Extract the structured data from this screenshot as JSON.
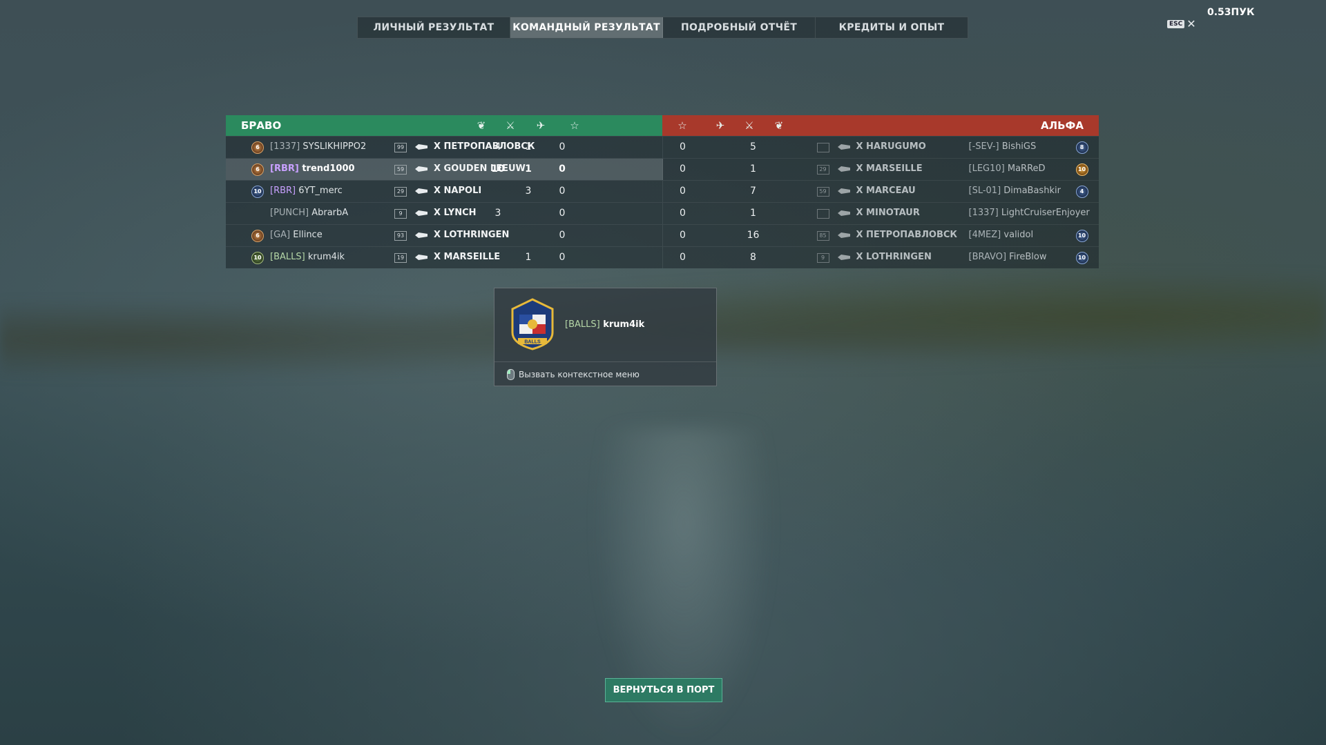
{
  "tabs": [
    {
      "label": "ЛИЧНЫЙ РЕЗУЛЬТАТ",
      "active": false
    },
    {
      "label": "КОМАНДНЫЙ РЕЗУЛЬТАТ",
      "active": true
    },
    {
      "label": "ПОДРОБНЫЙ ОТЧЁТ",
      "active": false
    },
    {
      "label": "КРЕДИТЫ И ОПЫТ",
      "active": false
    }
  ],
  "top_right": {
    "fps": "0.53ПУК",
    "esc_key": "ESC",
    "close_glyph": "✕"
  },
  "teams": {
    "left": {
      "name": "БРАВО",
      "color": "#2b8a5e",
      "header_icons": [
        "laurel-icon",
        "crossed-swords-icon",
        "plane-icon",
        "star-icon"
      ]
    },
    "right": {
      "name": "АЛЬФА",
      "color": "#a8392b",
      "header_icons": [
        "star-icon",
        "plane-icon",
        "crossed-swords-icon",
        "laurel-icon"
      ]
    }
  },
  "left_rows": [
    {
      "clan": "[1337]",
      "name": "SYSLIKHIPPO2",
      "badge": "bronze",
      "badge_label": "6",
      "level": "99",
      "ship": "X ПЕТРОПАВЛОВСК",
      "kills": "4",
      "planes": "1",
      "base": "0"
    },
    {
      "clan": "[RBR]",
      "name": "trend1000",
      "badge": "bronze",
      "badge_label": "6",
      "level": "59",
      "ship": "X GOUDEN LEEUW",
      "kills": "10",
      "planes": "1",
      "base": "0",
      "highlight": true
    },
    {
      "clan": "[RBR]",
      "name": "6YT_merc",
      "badge": "blue",
      "badge_label": "10",
      "level": "29",
      "ship": "X NAPOLI",
      "kills": "",
      "planes": "3",
      "base": "0"
    },
    {
      "clan": "[PUNCH]",
      "name": "AbrarbA",
      "badge": "",
      "badge_label": "",
      "level": "9",
      "ship": "X LYNCH",
      "kills": "3",
      "planes": "",
      "base": "0"
    },
    {
      "clan": "[GA]",
      "name": "Ellince",
      "badge": "bronze",
      "badge_label": "6",
      "level": "93",
      "ship": "X LOTHRINGEN",
      "kills": "",
      "planes": "",
      "base": "0"
    },
    {
      "clan": "[BALLS]",
      "name": "krum4ik",
      "badge": "green",
      "badge_label": "10",
      "level": "19",
      "ship": "X MARSEILLE",
      "kills": "",
      "planes": "1",
      "base": "0"
    }
  ],
  "right_rows": [
    {
      "base": "0",
      "planes": "5",
      "kills": "",
      "level": "",
      "ship": "X HARUGUMO",
      "clan": "[-SEV-]",
      "name": "BishiGS",
      "badge": "blue",
      "badge_label": "8"
    },
    {
      "base": "0",
      "planes": "1",
      "kills": "",
      "level": "29",
      "ship": "X MARSEILLE",
      "clan": "[LEG10]",
      "name": "MaRReD",
      "badge": "gold",
      "badge_label": "10"
    },
    {
      "base": "0",
      "planes": "7",
      "kills": "",
      "level": "59",
      "ship": "X MARCEAU",
      "clan": "[SL-01]",
      "name": "DimaBashkir",
      "badge": "blue",
      "badge_label": "4"
    },
    {
      "base": "0",
      "planes": "1",
      "kills": "",
      "level": "",
      "ship": "X MINOTAUR",
      "clan": "[1337]",
      "name": "LightCruiserEnjoyer",
      "badge": "",
      "badge_label": ""
    },
    {
      "base": "0",
      "planes": "16",
      "kills": "",
      "level": "85",
      "ship": "X ПЕТРОПАВЛОВСК",
      "clan": "[4MEZ]",
      "name": "validol",
      "badge": "blue",
      "badge_label": "10"
    },
    {
      "base": "0",
      "planes": "8",
      "kills": "",
      "level": "9",
      "ship": "X LOTHRINGEN",
      "clan": "[BRAVO]",
      "name": "FireBlow",
      "badge": "blue",
      "badge_label": "10"
    }
  ],
  "popup": {
    "clan": "[BALLS]",
    "name": "krum4ik",
    "emblem_text": "BALLS",
    "context_hint": "Вызвать контекстное меню"
  },
  "return_button": "ВЕРНУТЬСЯ В ПОРТ"
}
